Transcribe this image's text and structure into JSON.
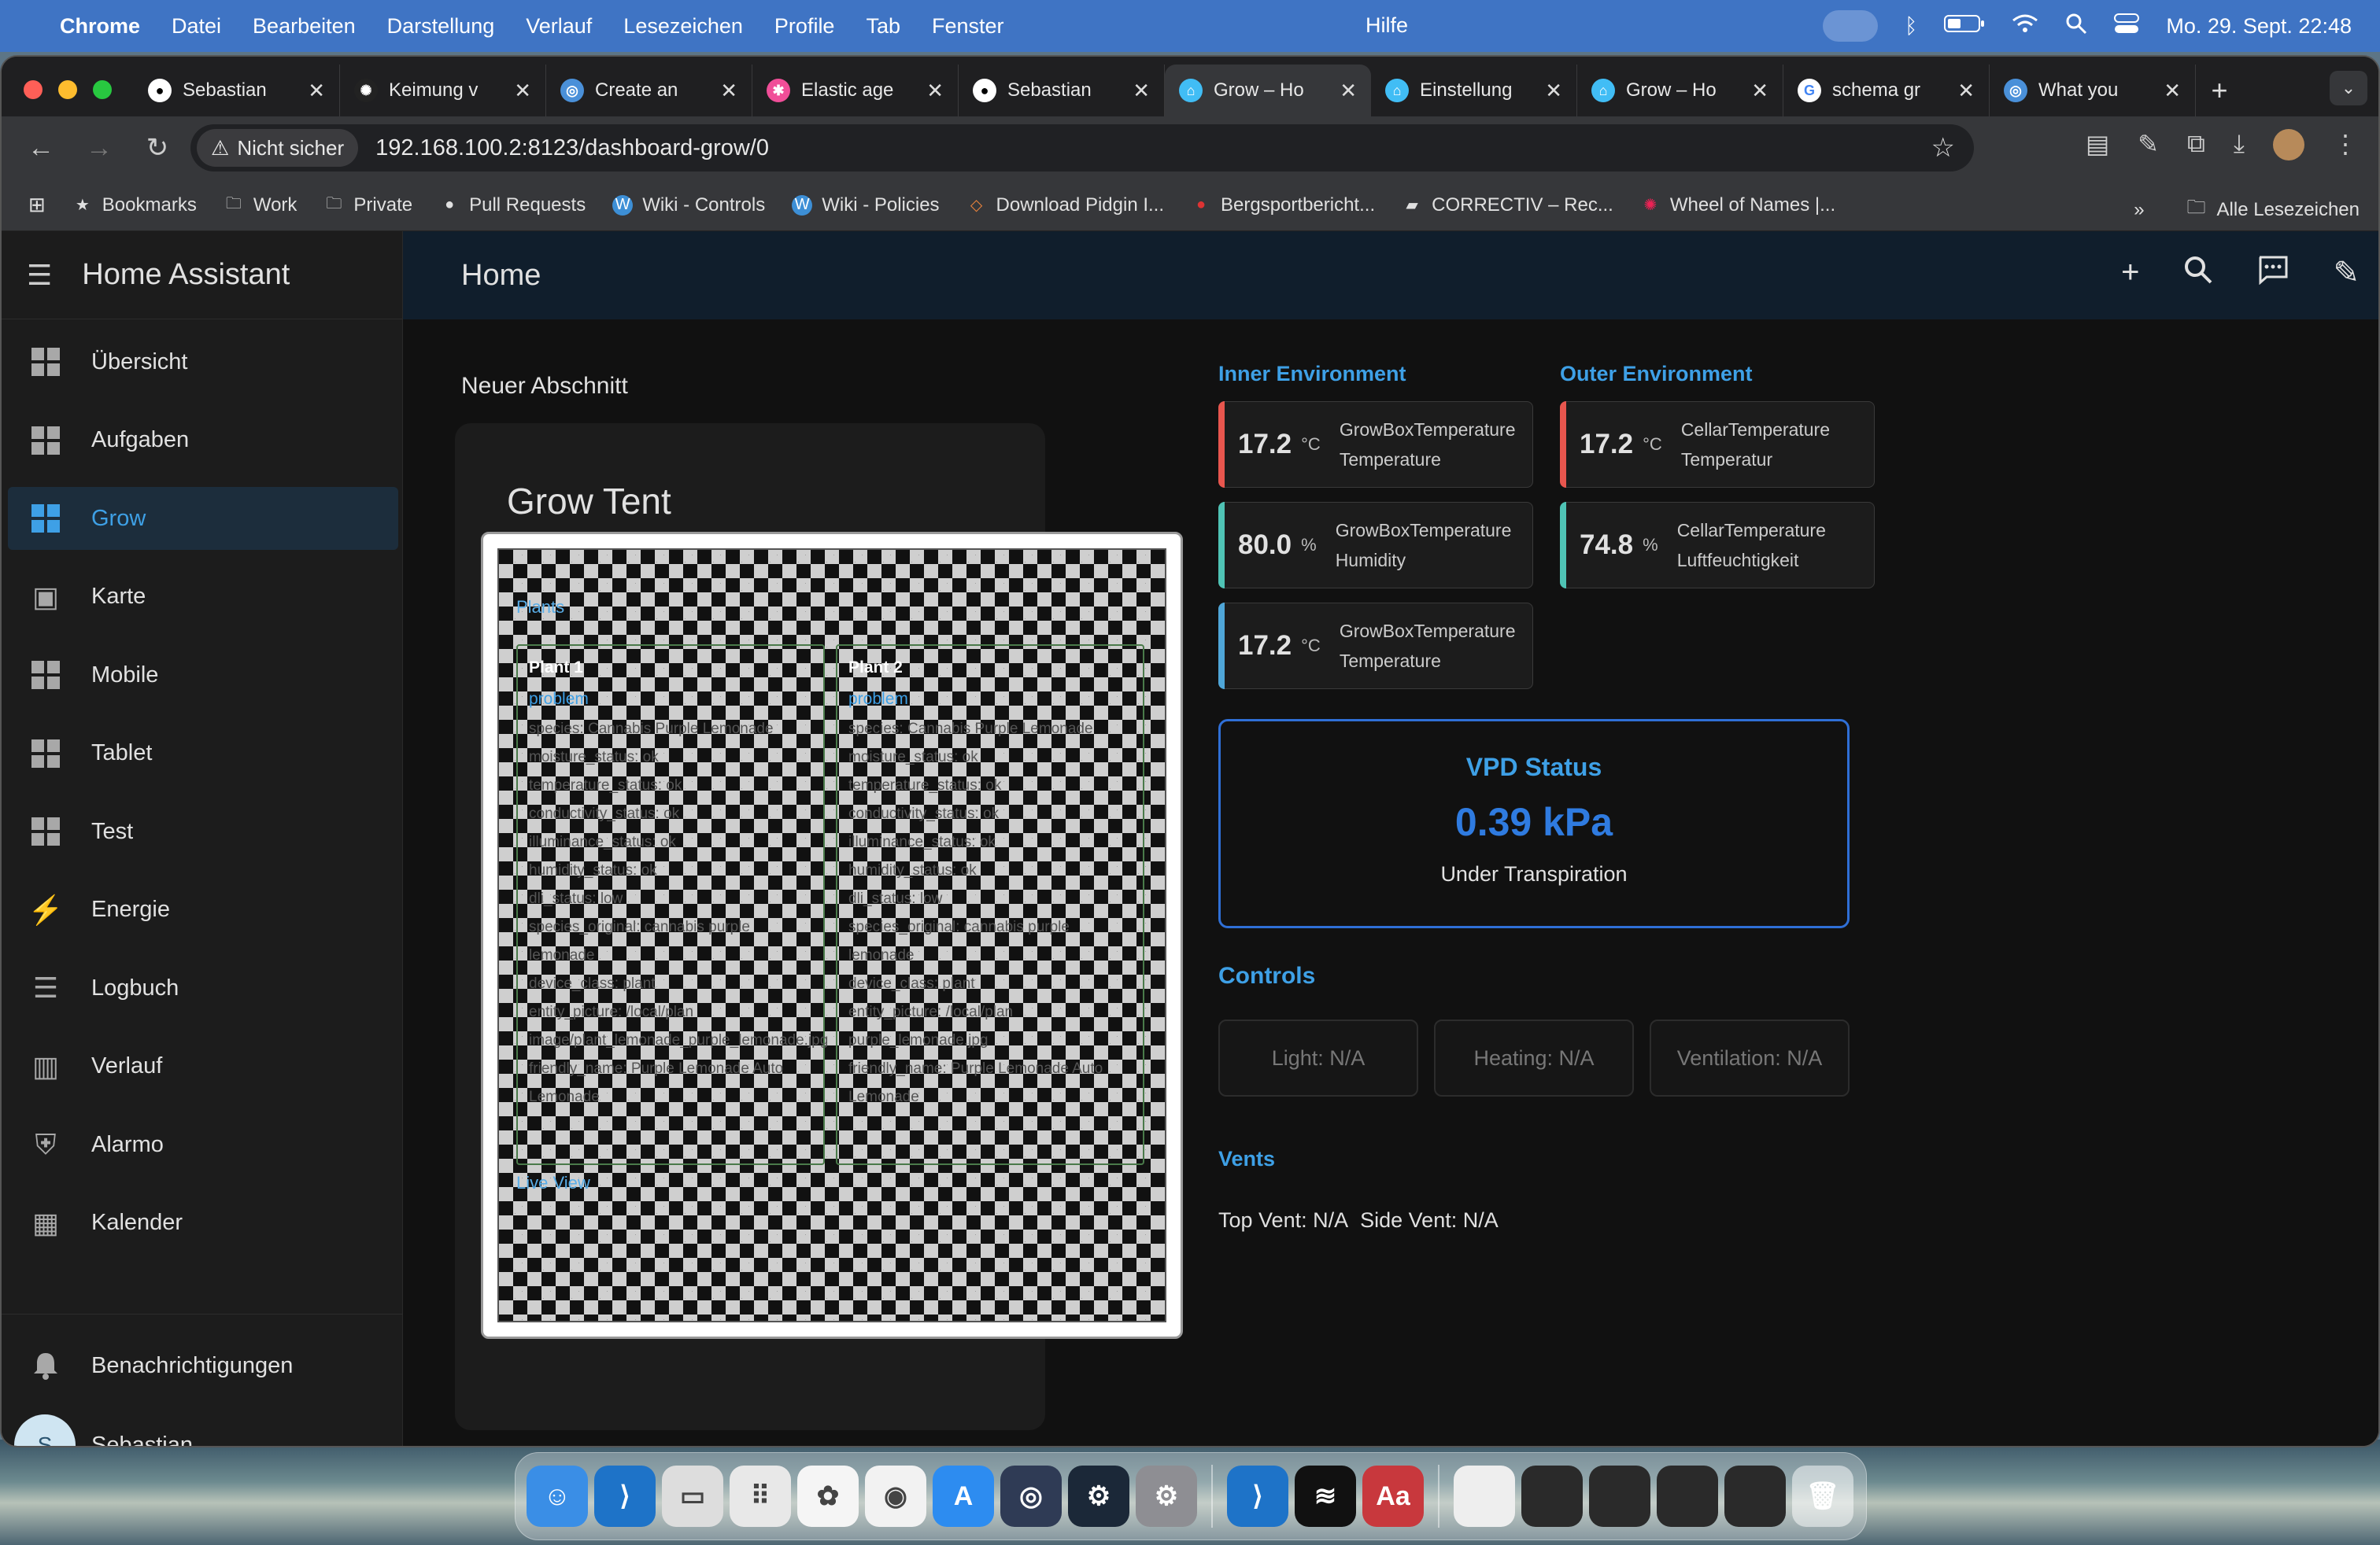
{
  "menubar": {
    "app": "Chrome",
    "items": [
      "Datei",
      "Bearbeiten",
      "Darstellung",
      "Verlauf",
      "Lesezeichen",
      "Profile",
      "Tab",
      "Fenster"
    ],
    "help": "Hilfe",
    "datetime": "Mo. 29. Sept.  22:48"
  },
  "tabs": [
    {
      "label": "Sebastian",
      "icon": "github-icon",
      "active": false
    },
    {
      "label": "Keimung v",
      "icon": "openai-icon",
      "active": false
    },
    {
      "label": "Create an",
      "icon": "globe-icon",
      "active": false
    },
    {
      "label": "Elastic age",
      "icon": "elastic-icon",
      "active": false
    },
    {
      "label": "Sebastian",
      "icon": "github-icon",
      "active": false
    },
    {
      "label": "Grow – Ho",
      "icon": "home-assistant-icon",
      "active": true
    },
    {
      "label": "Einstellung",
      "icon": "home-assistant-icon",
      "active": false
    },
    {
      "label": "Grow – Ho",
      "icon": "home-assistant-icon",
      "active": false
    },
    {
      "label": "schema gr",
      "icon": "google-icon",
      "active": false
    },
    {
      "label": "What you",
      "icon": "globe-icon",
      "active": false
    }
  ],
  "toolbar": {
    "not_secure": "Nicht sicher",
    "url": "192.168.100.2:8123/dashboard-grow/0"
  },
  "bookmarks": {
    "items": [
      "Bookmarks",
      "Work",
      "Private",
      "Pull Requests",
      "Wiki - Controls",
      "Wiki - Policies",
      "Download Pidgin I...",
      "Bergsportbericht...",
      "CORRECTIV – Rec...",
      "Wheel of Names |..."
    ],
    "all": "Alle Lesezeichen"
  },
  "sidebar": {
    "title": "Home Assistant",
    "items": [
      "Übersicht",
      "Aufgaben",
      "Grow",
      "Karte",
      "Mobile",
      "Tablet",
      "Test",
      "Energie",
      "Logbuch",
      "Verlauf",
      "Alarmo",
      "Kalender"
    ],
    "selected": "Grow",
    "notifications": "Benachrichtigungen",
    "user": "Sebastian",
    "user_initial": "S"
  },
  "header": {
    "title": "Home"
  },
  "section": {
    "title": "Neuer Abschnitt",
    "card_title": "Grow Tent",
    "overlay": {
      "plants_label": "Plants",
      "live_view_label": "Live View",
      "plant1": {
        "name": "Plant 1",
        "problem": "problem",
        "attrs": [
          "species: Cannabis Purple Lemonade",
          "moisture_status: ok",
          "temperature_status: ok",
          "conductivity_status: ok",
          "illuminance_status: ok",
          "humidity_status: ok",
          "dli_status: low",
          "species_original: cannabis purple",
          "lemonade",
          "device_class: plant",
          "entity_picture: /local/plan",
          "image/plant_lemonade_purple_lemonade.jpg",
          "friendly_name: Purple Lemonade Auto",
          "Lemonade"
        ]
      },
      "plant2": {
        "name": "Plant 2",
        "problem": "problem",
        "attrs": [
          "species: Cannabis Purple Lemonade",
          "moisture_status: ok",
          "temperature_status: ok",
          "conductivity_status: ok",
          "illuminance_status: ok",
          "humidity_status: ok",
          "dli_status: low",
          "species_original: cannabis purple",
          "lemonade",
          "device_class: plant",
          "entity_picture: /local/plan",
          "purple_lemonade.jpg",
          "friendly_name: Purple Lemonade Auto",
          "Lemonade"
        ]
      }
    }
  },
  "inner": {
    "title": "Inner Environment",
    "tiles": [
      {
        "value": "17.2",
        "unit": "°C",
        "name": "GrowBoxTemperature",
        "sub": "Temperature",
        "color": "#e8564e"
      },
      {
        "value": "80.0",
        "unit": "%",
        "name": "GrowBoxTemperature",
        "sub": "Humidity",
        "color": "#4fc3b5"
      },
      {
        "value": "17.2",
        "unit": "°C",
        "name": "GrowBoxTemperature",
        "sub": "Temperature",
        "color": "#4fa6d8"
      }
    ]
  },
  "outer": {
    "title": "Outer Environment",
    "tiles": [
      {
        "value": "17.2",
        "unit": "°C",
        "name": "CellarTemperature",
        "sub": "Temperatur",
        "color": "#e8564e"
      },
      {
        "value": "74.8",
        "unit": "%",
        "name": "CellarTemperature",
        "sub": "Luftfeuchtigkeit",
        "color": "#4fc3b5"
      }
    ]
  },
  "vpd": {
    "title": "VPD Status",
    "value": "0.39 kPa",
    "status": "Under Transpiration",
    "accent": "#2f6fd6"
  },
  "controls": {
    "title": "Controls",
    "items": [
      "Light: N/A",
      "Heating: N/A",
      "Ventilation: N/A"
    ]
  },
  "vents": {
    "title": "Vents",
    "top": "Top Vent: N/A",
    "side": "Side Vent: N/A"
  },
  "dock": [
    "finder-icon",
    "vscode-icon",
    "notes-icon",
    "launchpad-icon",
    "photos-icon",
    "chrome-icon",
    "app-store-icon",
    "dropbox-icon",
    "steam-icon",
    "settings-icon",
    "vscode-icon",
    "spotify-icon",
    "dictionary-icon"
  ],
  "colors": {
    "ha_blue": "#3ea0e6",
    "topbar": "#101e2c",
    "menubar": "#3f74c4"
  }
}
